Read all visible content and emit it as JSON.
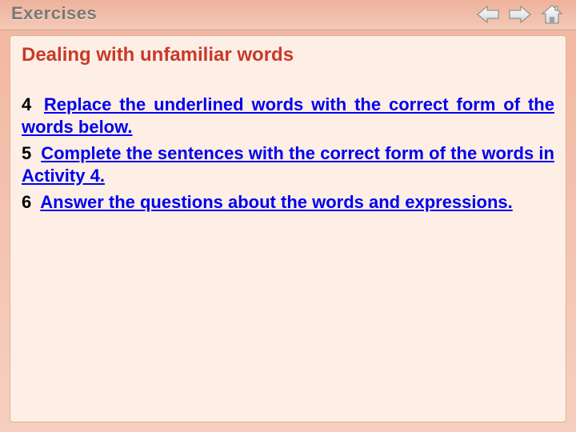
{
  "header": {
    "title": "Exercises"
  },
  "icons": {
    "back": "back-arrow",
    "forward": "forward-arrow",
    "home": "home"
  },
  "section": {
    "title": "Dealing with unfamiliar words"
  },
  "exercises": [
    {
      "num": "4",
      "text": "Replace the underlined words with the correct form of the words below."
    },
    {
      "num": "5",
      "text": "Complete the sentences with the correct form of the words in Activity 4."
    },
    {
      "num": "6",
      "text": "Answer the questions about the words and expressions."
    }
  ]
}
